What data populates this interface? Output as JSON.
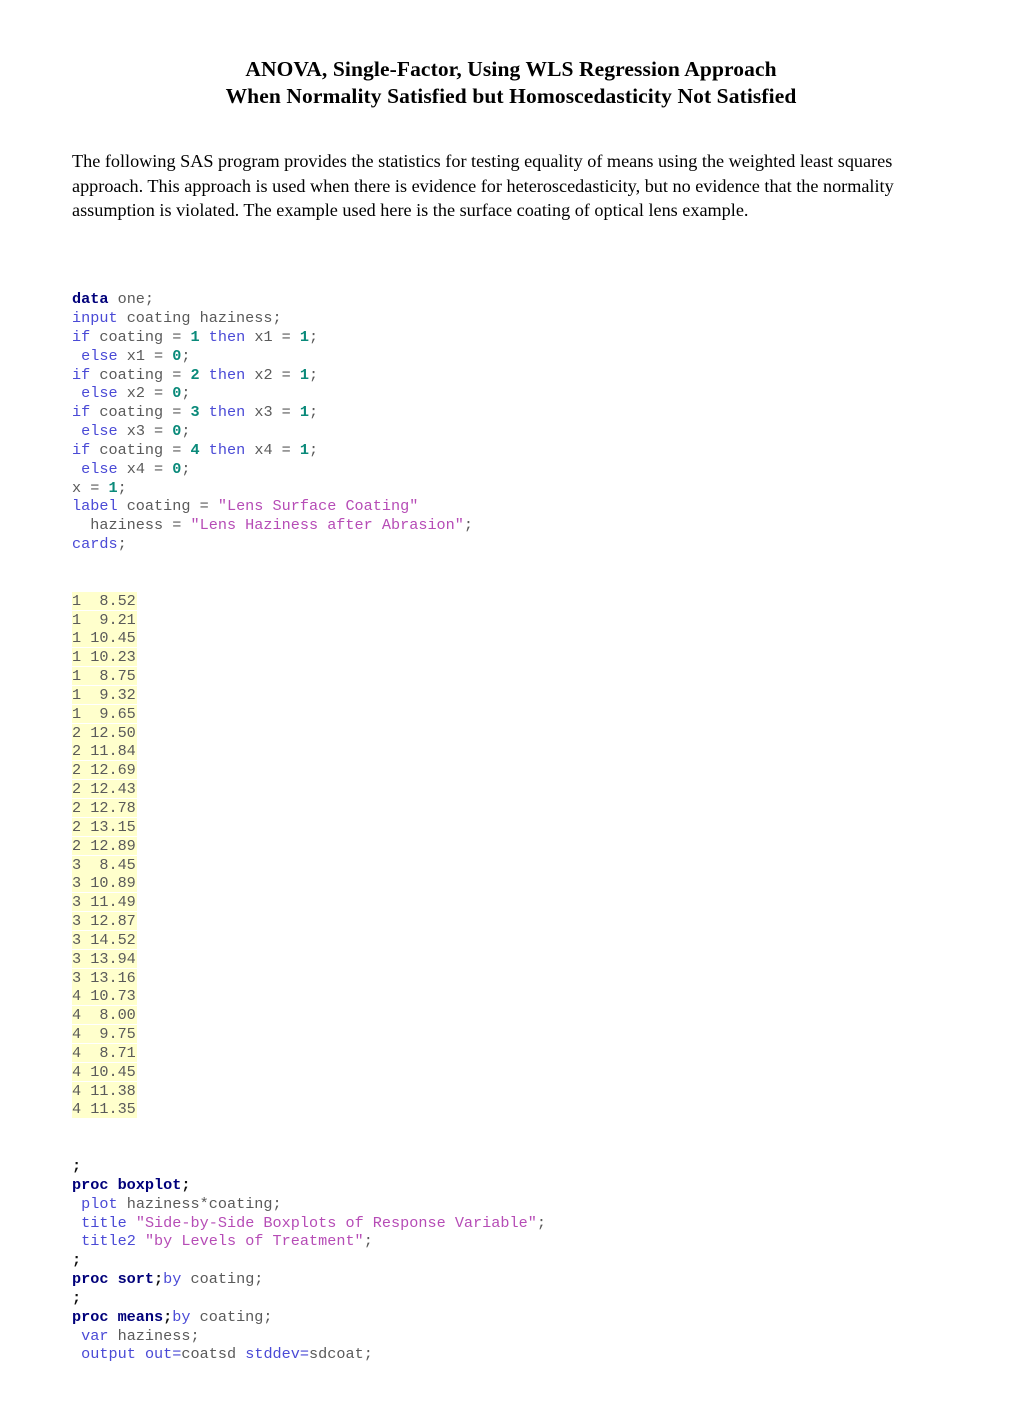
{
  "document": {
    "title_lines": [
      "ANOVA, Single-Factor, Using WLS Regression Approach",
      "When Normality Satisfied but Homoscedasticity Not Satisfied"
    ],
    "intro_paragraph": "The following SAS program provides the statistics for testing equality of means using the weighted least squares approach.  This approach is used when there is evidence for heteroscedasticity, but no evidence that the normality assumption is violated.  The example used here is the surface coating of optical lens example."
  },
  "colors": {
    "proc_keyword": "#00007a",
    "keyword": "#4a4ad6",
    "plain_text": "#5a5a5a",
    "number": "#0a8a7a",
    "string": "#b64cb6",
    "data_highlight": "#ffffcc",
    "page_background": "#ffffff"
  },
  "code": {
    "lines_before_data": [
      [
        {
          "t": "data",
          "c": "proc"
        },
        {
          "t": " one;",
          "c": "plain"
        }
      ],
      [
        {
          "t": "input",
          "c": "kw"
        },
        {
          "t": " coating haziness;",
          "c": "plain"
        }
      ],
      [
        {
          "t": "if",
          "c": "kw"
        },
        {
          "t": " coating = ",
          "c": "plain"
        },
        {
          "t": "1",
          "c": "num"
        },
        {
          "t": " ",
          "c": "plain"
        },
        {
          "t": "then",
          "c": "kw"
        },
        {
          "t": " x1 = ",
          "c": "plain"
        },
        {
          "t": "1",
          "c": "num"
        },
        {
          "t": ";",
          "c": "plain"
        }
      ],
      [
        {
          "t": " ",
          "c": "plain"
        },
        {
          "t": "else",
          "c": "kw"
        },
        {
          "t": " x1 = ",
          "c": "plain"
        },
        {
          "t": "0",
          "c": "num"
        },
        {
          "t": ";",
          "c": "plain"
        }
      ],
      [
        {
          "t": "if",
          "c": "kw"
        },
        {
          "t": " coating = ",
          "c": "plain"
        },
        {
          "t": "2",
          "c": "num"
        },
        {
          "t": " ",
          "c": "plain"
        },
        {
          "t": "then",
          "c": "kw"
        },
        {
          "t": " x2 = ",
          "c": "plain"
        },
        {
          "t": "1",
          "c": "num"
        },
        {
          "t": ";",
          "c": "plain"
        }
      ],
      [
        {
          "t": " ",
          "c": "plain"
        },
        {
          "t": "else",
          "c": "kw"
        },
        {
          "t": " x2 = ",
          "c": "plain"
        },
        {
          "t": "0",
          "c": "num"
        },
        {
          "t": ";",
          "c": "plain"
        }
      ],
      [
        {
          "t": "if",
          "c": "kw"
        },
        {
          "t": " coating = ",
          "c": "plain"
        },
        {
          "t": "3",
          "c": "num"
        },
        {
          "t": " ",
          "c": "plain"
        },
        {
          "t": "then",
          "c": "kw"
        },
        {
          "t": " x3 = ",
          "c": "plain"
        },
        {
          "t": "1",
          "c": "num"
        },
        {
          "t": ";",
          "c": "plain"
        }
      ],
      [
        {
          "t": " ",
          "c": "plain"
        },
        {
          "t": "else",
          "c": "kw"
        },
        {
          "t": " x3 = ",
          "c": "plain"
        },
        {
          "t": "0",
          "c": "num"
        },
        {
          "t": ";",
          "c": "plain"
        }
      ],
      [
        {
          "t": "if",
          "c": "kw"
        },
        {
          "t": " coating = ",
          "c": "plain"
        },
        {
          "t": "4",
          "c": "num"
        },
        {
          "t": " ",
          "c": "plain"
        },
        {
          "t": "then",
          "c": "kw"
        },
        {
          "t": " x4 = ",
          "c": "plain"
        },
        {
          "t": "1",
          "c": "num"
        },
        {
          "t": ";",
          "c": "plain"
        }
      ],
      [
        {
          "t": " ",
          "c": "plain"
        },
        {
          "t": "else",
          "c": "kw"
        },
        {
          "t": " x4 = ",
          "c": "plain"
        },
        {
          "t": "0",
          "c": "num"
        },
        {
          "t": ";",
          "c": "plain"
        }
      ],
      [
        {
          "t": "x = ",
          "c": "plain"
        },
        {
          "t": "1",
          "c": "num"
        },
        {
          "t": ";",
          "c": "plain"
        }
      ],
      [
        {
          "t": "label",
          "c": "kw"
        },
        {
          "t": " coating = ",
          "c": "plain"
        },
        {
          "t": "\"Lens Surface Coating\"",
          "c": "str"
        }
      ],
      [
        {
          "t": "  haziness = ",
          "c": "plain"
        },
        {
          "t": "\"Lens Haziness after Abrasion\"",
          "c": "str"
        },
        {
          "t": ";",
          "c": "plain"
        }
      ],
      [
        {
          "t": "cards",
          "c": "kw"
        },
        {
          "t": ";",
          "c": "plain"
        }
      ]
    ],
    "data_rows": [
      "1  8.52",
      "1  9.21",
      "1 10.45",
      "1 10.23",
      "1  8.75",
      "1  9.32",
      "1  9.65",
      "2 12.50",
      "2 11.84",
      "2 12.69",
      "2 12.43",
      "2 12.78",
      "2 13.15",
      "2 12.89",
      "3  8.45",
      "3 10.89",
      "3 11.49",
      "3 12.87",
      "3 14.52",
      "3 13.94",
      "3 13.16",
      "4 10.73",
      "4  8.00",
      "4  9.75",
      "4  8.71",
      "4 10.45",
      "4 11.38",
      "4 11.35"
    ],
    "lines_after_data": [
      [
        {
          "t": ";",
          "c": "semi"
        }
      ],
      [
        {
          "t": "proc boxplot",
          "c": "proc"
        },
        {
          "t": ";",
          "c": "semi"
        }
      ],
      [
        {
          "t": " ",
          "c": "plain"
        },
        {
          "t": "plot",
          "c": "kw"
        },
        {
          "t": " haziness*coating;",
          "c": "plain"
        }
      ],
      [
        {
          "t": " ",
          "c": "plain"
        },
        {
          "t": "title",
          "c": "kw"
        },
        {
          "t": " ",
          "c": "plain"
        },
        {
          "t": "\"Side-by-Side Boxplots of Response Variable\"",
          "c": "str"
        },
        {
          "t": ";",
          "c": "plain"
        }
      ],
      [
        {
          "t": " ",
          "c": "plain"
        },
        {
          "t": "title2",
          "c": "kw"
        },
        {
          "t": " ",
          "c": "plain"
        },
        {
          "t": "\"by Levels of Treatment\"",
          "c": "str"
        },
        {
          "t": ";",
          "c": "plain"
        }
      ],
      [
        {
          "t": ";",
          "c": "semi"
        }
      ],
      [
        {
          "t": "proc sort",
          "c": "proc"
        },
        {
          "t": ";",
          "c": "semi"
        },
        {
          "t": "by",
          "c": "kw"
        },
        {
          "t": " coating;",
          "c": "plain"
        }
      ],
      [
        {
          "t": ";",
          "c": "semi"
        }
      ],
      [
        {
          "t": "proc means",
          "c": "proc"
        },
        {
          "t": ";",
          "c": "semi"
        },
        {
          "t": "by",
          "c": "kw"
        },
        {
          "t": " coating;",
          "c": "plain"
        }
      ],
      [
        {
          "t": " ",
          "c": "plain"
        },
        {
          "t": "var",
          "c": "kw"
        },
        {
          "t": " haziness;",
          "c": "plain"
        }
      ],
      [
        {
          "t": " ",
          "c": "plain"
        },
        {
          "t": "output",
          "c": "kw"
        },
        {
          "t": " ",
          "c": "plain"
        },
        {
          "t": "out=",
          "c": "kw"
        },
        {
          "t": "coatsd ",
          "c": "plain"
        },
        {
          "t": "stddev=",
          "c": "kw"
        },
        {
          "t": "sdcoat;",
          "c": "plain"
        }
      ]
    ]
  }
}
